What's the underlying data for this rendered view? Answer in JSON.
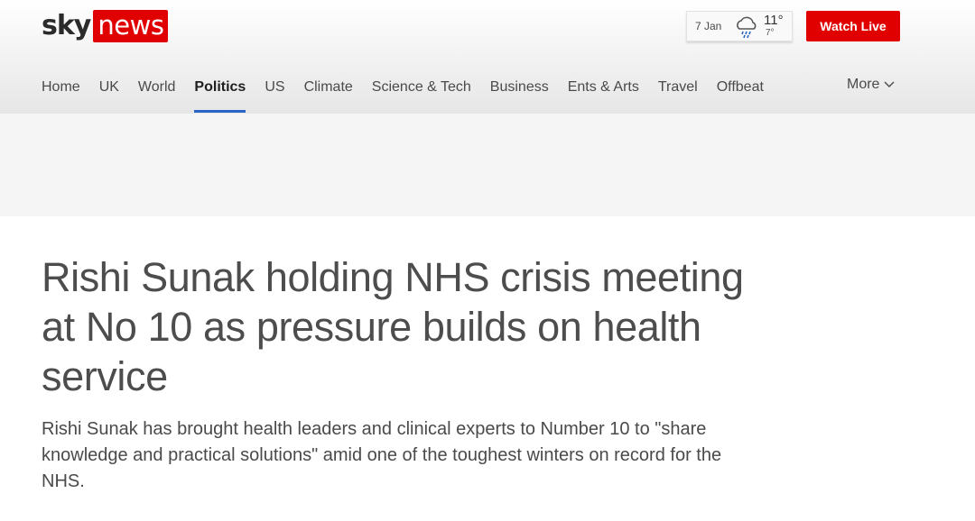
{
  "brand": {
    "sky": "sky",
    "news": "news",
    "news_bg": "#e10000"
  },
  "weather": {
    "date": "7 Jan",
    "high": "11°",
    "low": "7°",
    "icon": "rain-cloud-icon"
  },
  "header": {
    "watch_live_label": "Watch Live",
    "accent": "#e10000"
  },
  "nav": {
    "items": [
      {
        "label": "Home"
      },
      {
        "label": "UK"
      },
      {
        "label": "World"
      },
      {
        "label": "Politics",
        "active": true
      },
      {
        "label": "US"
      },
      {
        "label": "Climate"
      },
      {
        "label": "Science & Tech"
      },
      {
        "label": "Business"
      },
      {
        "label": "Ents & Arts"
      },
      {
        "label": "Travel"
      },
      {
        "label": "Offbeat"
      }
    ],
    "more_label": "More",
    "active_underline": "#2a64c5"
  },
  "article": {
    "headline": "Rishi Sunak holding NHS crisis meeting at No 10 as pressure builds on health service",
    "standfirst": "Rishi Sunak has brought health leaders and clinical experts to Number 10 to \"share knowledge and practical solutions\" amid one of the toughest winters on record for the NHS."
  }
}
